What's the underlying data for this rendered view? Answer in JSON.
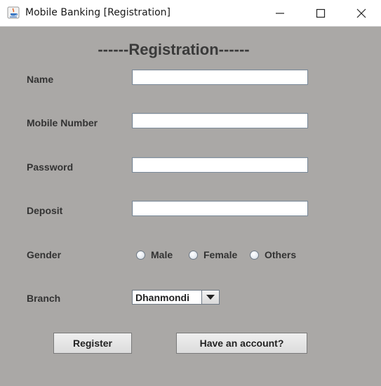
{
  "window": {
    "title": "Mobile Banking [Registration]"
  },
  "form": {
    "heading": "------Registration------",
    "name_label": "Name",
    "mobile_label": "Mobile Number",
    "password_label": "Password",
    "deposit_label": "Deposit",
    "gender_label": "Gender",
    "branch_label": "Branch",
    "name_value": "",
    "mobile_value": "",
    "password_value": "",
    "deposit_value": "",
    "gender_options": [
      "Male",
      "Female",
      "Others"
    ],
    "branch_selected": "Dhanmondi"
  },
  "buttons": {
    "register": "Register",
    "have_account": "Have an account?"
  },
  "colors": {
    "background": "#aaa8a6",
    "titlebar": "#ffffff",
    "field": "#ffffff"
  }
}
